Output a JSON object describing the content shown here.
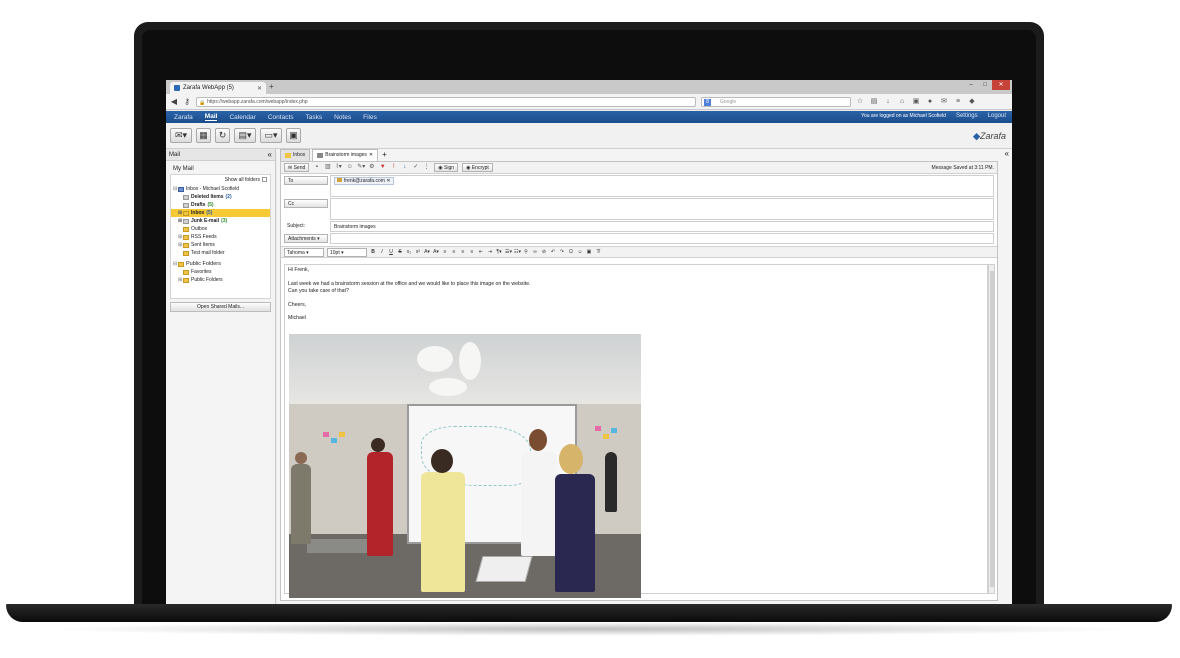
{
  "browser": {
    "tab_title": "Zarafa WebApp (5)",
    "url": "https://webapp.zarafa.com/webapp/index.php",
    "search_placeholder": "Google",
    "window_close": "✕"
  },
  "app_nav": {
    "items": [
      "Zarafa",
      "Mail",
      "Calendar",
      "Contacts",
      "Tasks",
      "Notes",
      "Files"
    ],
    "active": "Mail",
    "logged_in_text": "You are logged on as Michael Scofield",
    "settings": "Settings",
    "logout": "Logout"
  },
  "logo": {
    "text": "Zarafa"
  },
  "left_panel": {
    "title": "Mail",
    "my_mail": "My Mail",
    "show_all_folders": "Show all folders",
    "open_shared": "Open Shared Mails...",
    "tree": [
      {
        "label": "Inbox - Michael Scofield",
        "count": ""
      },
      {
        "label": "Deleted Items",
        "count": "(2)"
      },
      {
        "label": "Drafts",
        "count": "(5)"
      },
      {
        "label": "Inbox",
        "count": "(5)"
      },
      {
        "label": "Junk E-mail",
        "count": "(3)"
      },
      {
        "label": "Outbox",
        "count": ""
      },
      {
        "label": "RSS Feeds",
        "count": ""
      },
      {
        "label": "Sent Items",
        "count": ""
      },
      {
        "label": "Test mail folder",
        "count": ""
      },
      {
        "label": "Public Folders",
        "count": ""
      },
      {
        "label": "Favorites",
        "count": ""
      },
      {
        "label": "Public Folders",
        "count": ""
      }
    ]
  },
  "content_tabs": [
    "Inbox",
    "Brainstorm images"
  ],
  "composer": {
    "send": "Send",
    "sign": "Sign",
    "encrypt": "Encrypt",
    "saved_status": "Message Saved at 3:11 PM.",
    "to_label": "To",
    "to_recipient": "frenk@zarafa.com",
    "cc_label": "Cc",
    "subject_label": "Subject:",
    "subject_value": "Brainstorm images",
    "attachments_label": "Attachments",
    "font": "Tahoma",
    "size": "10pt",
    "body": {
      "greeting": "Hi Frenk,",
      "line1": "Last week we had a brainstorm session at the office and we would like to place this image on the website.",
      "line2": "Can you take care of that?",
      "closing": "Cheers,",
      "signature": "Michael"
    }
  },
  "colors": {
    "nav_blue": "#1c4d8c",
    "selected_folder": "#f7c934",
    "count_blue": "#2a62a8",
    "count_green": "#2c8a2c"
  }
}
